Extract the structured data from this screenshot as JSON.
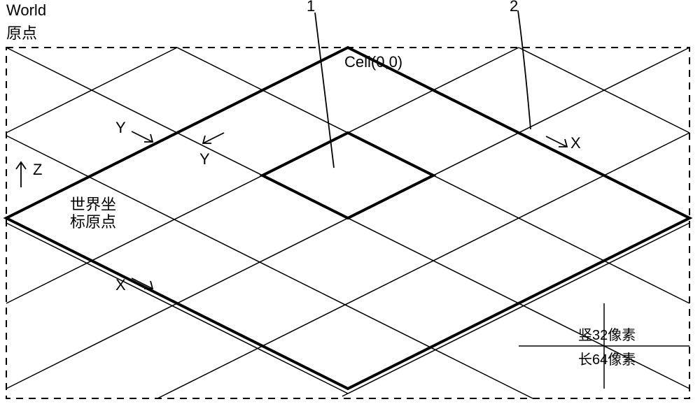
{
  "title": {
    "line1": "World",
    "line2": "原点"
  },
  "cell_label": "Cell(0,0)",
  "world_origin": {
    "line1": "世界坐",
    "line2": "标原点"
  },
  "axes": {
    "z": "Z",
    "y": "Y",
    "x": "X",
    "cell_y": "Y",
    "cell_x": "X"
  },
  "callouts": {
    "one": "1",
    "two": "2"
  },
  "dims": {
    "height": "竖32像素",
    "width": "长64像素"
  }
}
